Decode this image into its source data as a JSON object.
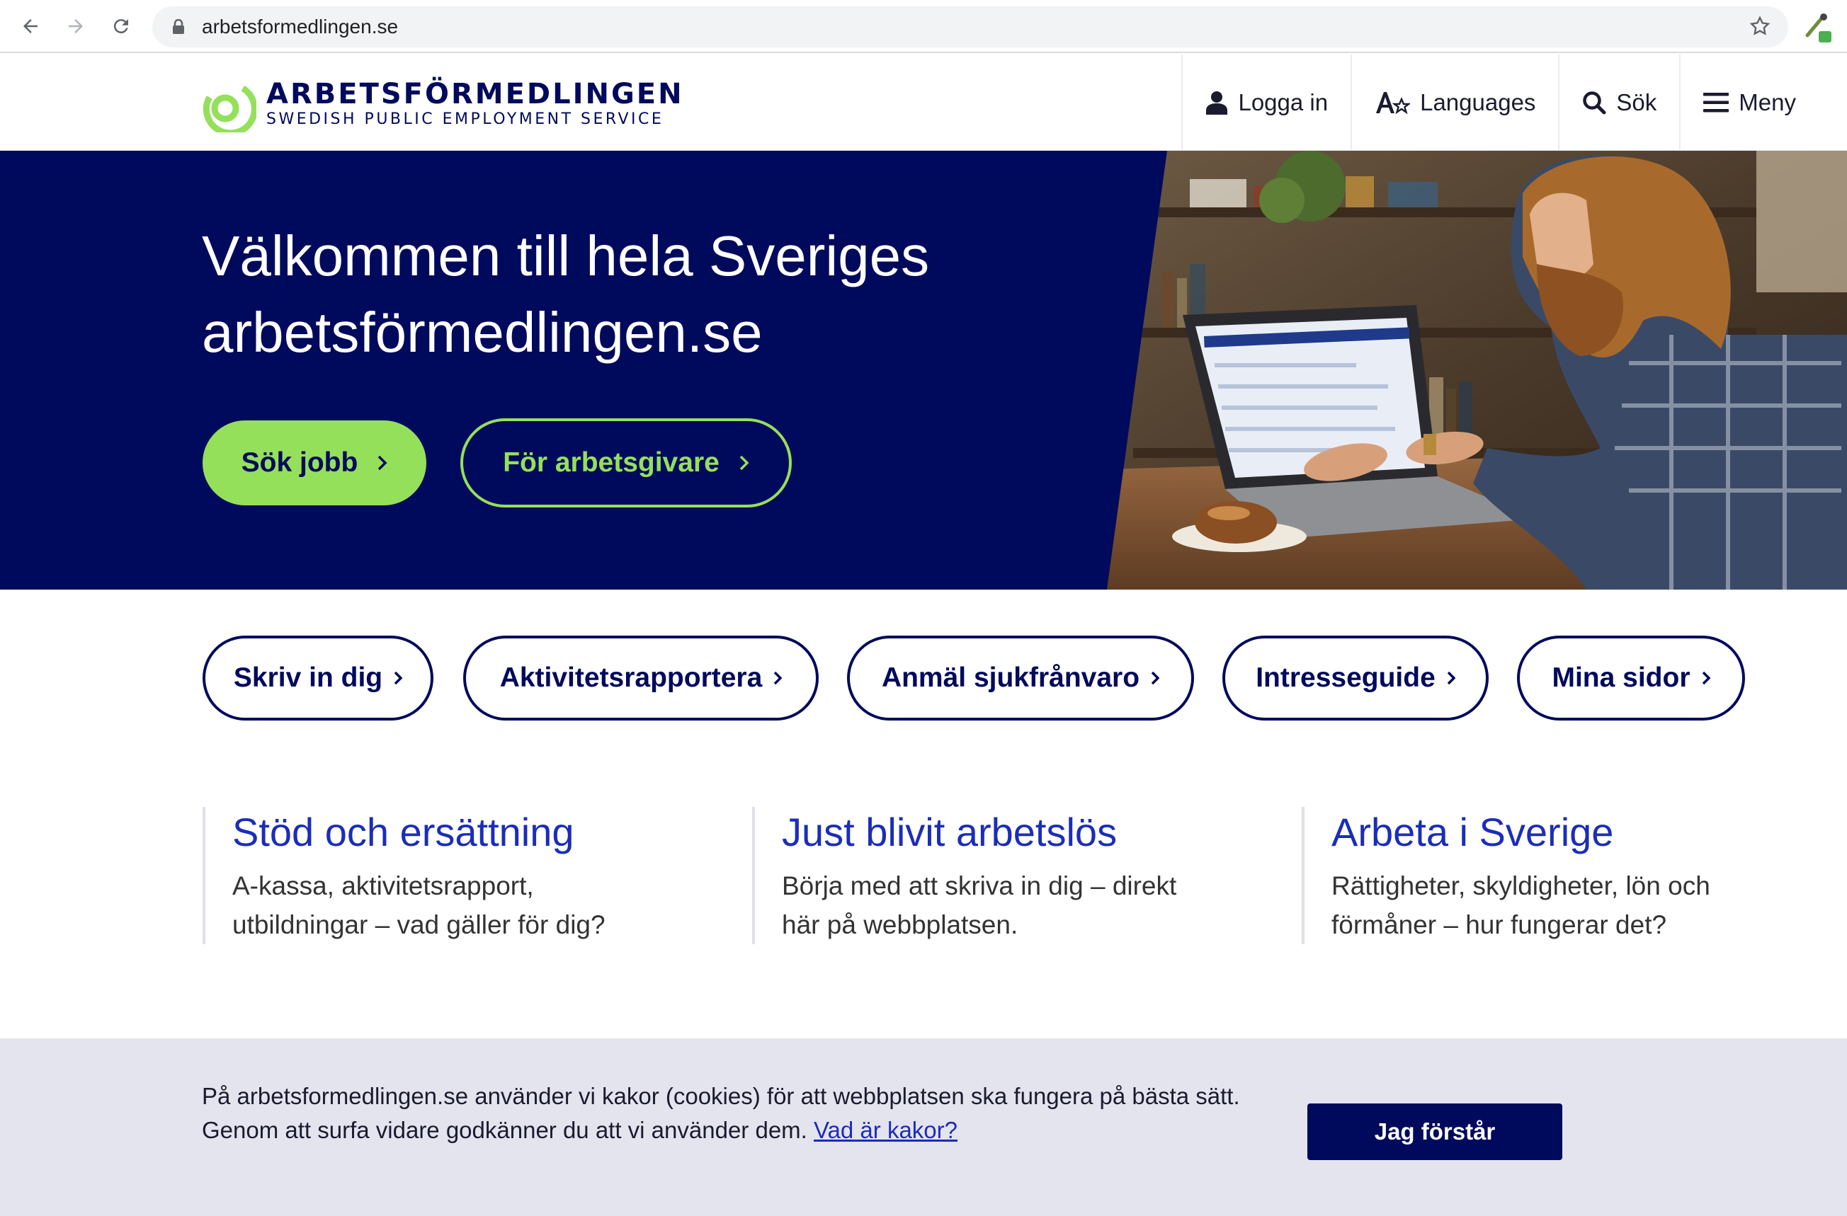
{
  "browser": {
    "url": "arbetsformedlingen.se"
  },
  "header": {
    "logo_name": "ARBETSFÖRMEDLINGEN",
    "logo_sub": "SWEDISH PUBLIC EMPLOYMENT SERVICE",
    "nav": [
      {
        "label": "Logga in",
        "icon": "user-icon"
      },
      {
        "label": "Languages",
        "icon": "translate-icon"
      },
      {
        "label": "Sök",
        "icon": "search-icon"
      },
      {
        "label": "Meny",
        "icon": "menu-icon"
      }
    ]
  },
  "hero": {
    "title_line1": "Välkommen till hela Sveriges",
    "title_line2": "arbetsförmedlingen.se",
    "primary_label": "Sök jobb",
    "secondary_label": "För arbetsgivare"
  },
  "quick_links": [
    {
      "label": "Skriv in dig"
    },
    {
      "label": "Aktivitetsrapportera"
    },
    {
      "label": "Anmäl sjukfrånvaro"
    },
    {
      "label": "Intresseguide"
    },
    {
      "label": "Mina sidor"
    }
  ],
  "info": [
    {
      "title": "Stöd och ersättning",
      "line1": "A-kassa, aktivitetsrapport,",
      "line2": "utbildningar – vad gäller för dig?"
    },
    {
      "title": "Just blivit arbetslös",
      "line1": "Börja med att skriva in dig – direkt",
      "line2": "här på webbplatsen."
    },
    {
      "title": "Arbeta i Sverige",
      "line1": "Rättigheter, skyldigheter, lön och",
      "line2": "förmåner – hur fungerar det?"
    }
  ],
  "cookie": {
    "line1": "På arbetsformedlingen.se använder vi kakor (cookies) för att webbplatsen ska fungera på bästa sätt.",
    "line2": "Genom att surfa vidare godkänner du att vi använder dem.",
    "link": "Vad är kakor?",
    "button": "Jag förstår"
  },
  "colors": {
    "navy": "#000a5c",
    "green": "#95e05a",
    "link_blue": "#1b2db8",
    "cookie_bg": "#e4e4ef"
  }
}
